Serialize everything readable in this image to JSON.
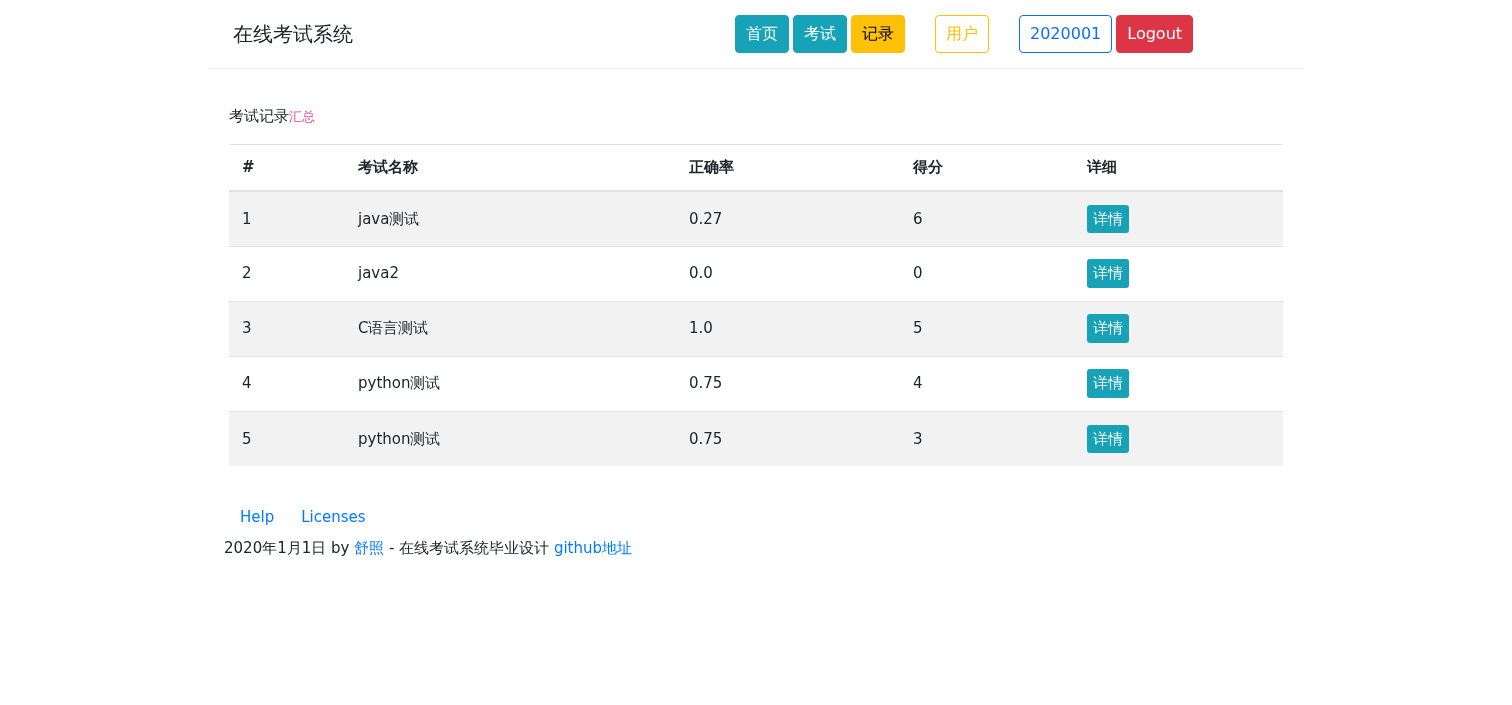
{
  "brand": "在线考试系统",
  "nav_groups": [
    [
      {
        "label": "首页",
        "kind": "info"
      },
      {
        "label": "考试",
        "kind": "info"
      },
      {
        "label": "记录",
        "kind": "warning"
      }
    ],
    [
      {
        "label": "用户",
        "kind": "outline-warning"
      }
    ],
    [
      {
        "label": "2020001",
        "kind": "outline-primary"
      },
      {
        "label": "Logout",
        "kind": "danger"
      }
    ]
  ],
  "section": {
    "title": "考试记录",
    "subtitle": "汇总"
  },
  "table": {
    "columns": [
      "#",
      "考试名称",
      "正确率",
      "得分",
      "详细"
    ],
    "rows": [
      {
        "cells": [
          "1",
          "java测试",
          "0.27",
          "6"
        ],
        "action": "详情"
      },
      {
        "cells": [
          "2",
          "java2",
          "0.0",
          "0"
        ],
        "action": "详情"
      },
      {
        "cells": [
          "3",
          "C语言测试",
          "1.0",
          "5"
        ],
        "action": "详情"
      },
      {
        "cells": [
          "4",
          "python测试",
          "0.75",
          "4"
        ],
        "action": "详情"
      },
      {
        "cells": [
          "5",
          "python测试",
          "0.75",
          "3"
        ],
        "action": "详情"
      }
    ]
  },
  "footer": {
    "links": [
      "Help",
      "Licenses"
    ],
    "line": [
      {
        "kind": "text",
        "text": "2020年1月1日 by "
      },
      {
        "kind": "link",
        "text": "舒照"
      },
      {
        "kind": "text",
        "text": " - 在线考试系统毕业设计 "
      },
      {
        "kind": "link",
        "text": "github地址"
      }
    ]
  }
}
